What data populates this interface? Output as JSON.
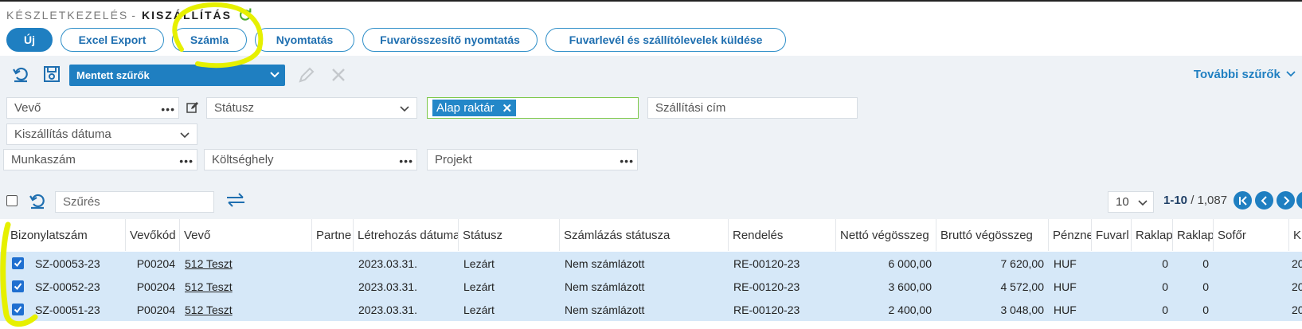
{
  "title": {
    "module": "KÉSZLETKEZELÉS",
    "separator": "-",
    "page": "KISZÁLLÍTÁS"
  },
  "actions": {
    "new": "Új",
    "excel_export": "Excel Export",
    "invoice": "Számla",
    "print": "Nyomtatás",
    "freight_print": "Fuvarösszesítő nyomtatás",
    "send_waybills": "Fuvarlevél és szállítólevelek küldése"
  },
  "filters": {
    "saved_filters": "Mentett szűrők",
    "more_filters": "További szűrők",
    "customer": "Vevő",
    "status": "Státusz",
    "warehouse_chip": "Alap raktár",
    "shipping_address": "Szállítási cím",
    "delivery_date": "Kiszállítás dátuma",
    "job_number": "Munkaszám",
    "cost_center": "Költséghely",
    "project": "Projekt"
  },
  "list_toolbar": {
    "search_placeholder": "Szűrés",
    "page_size": "10",
    "range": "1-10",
    "total": "/ 1,087"
  },
  "table": {
    "columns": [
      "Bizonylatszám",
      "Vevőkód",
      "Vevő",
      "Partne",
      "Létrehozás dátuma",
      "Státusz",
      "Számlázás státusza",
      "Rendelés",
      "Nettó végösszeg",
      "Bruttó végösszeg",
      "Pénznem",
      "Fuvarl",
      "Raklap",
      "Raklap",
      "Sofőr",
      "Kü"
    ],
    "rows": [
      {
        "doc": "SZ-00053-23",
        "code": "P00204",
        "customer": "512 Teszt",
        "partner": "",
        "created": "2023.03.31.",
        "status": "Lezárt",
        "billing": "Nem számlázott",
        "order": "RE-00120-23",
        "net": "6 000,00",
        "gross": "7 620,00",
        "currency": "HUF",
        "freight": "",
        "pallet1": "0",
        "pallet2": "0",
        "driver": "",
        "extra": "20"
      },
      {
        "doc": "SZ-00052-23",
        "code": "P00204",
        "customer": "512 Teszt",
        "partner": "",
        "created": "2023.03.31.",
        "status": "Lezárt",
        "billing": "Nem számlázott",
        "order": "RE-00120-23",
        "net": "3 600,00",
        "gross": "4 572,00",
        "currency": "HUF",
        "freight": "",
        "pallet1": "0",
        "pallet2": "0",
        "driver": "",
        "extra": "20"
      },
      {
        "doc": "SZ-00051-23",
        "code": "P00204",
        "customer": "512 Teszt",
        "partner": "",
        "created": "2023.03.31.",
        "status": "Lezárt",
        "billing": "Nem számlázott",
        "order": "RE-00120-23",
        "net": "2 400,00",
        "gross": "3 048,00",
        "currency": "HUF",
        "freight": "",
        "pallet1": "0",
        "pallet2": "0",
        "driver": "",
        "extra": "20"
      }
    ]
  },
  "colors": {
    "accent": "#1f7fc1",
    "row_selected": "#d6e8f8",
    "highlight": "#e6f000",
    "chip_border": "#7dc84a"
  },
  "icons": [
    "refresh-icon",
    "save-icon",
    "edit-icon",
    "close-icon",
    "chevron-down-icon",
    "swap-icon",
    "first-page-icon",
    "prev-page-icon",
    "next-page-icon"
  ]
}
